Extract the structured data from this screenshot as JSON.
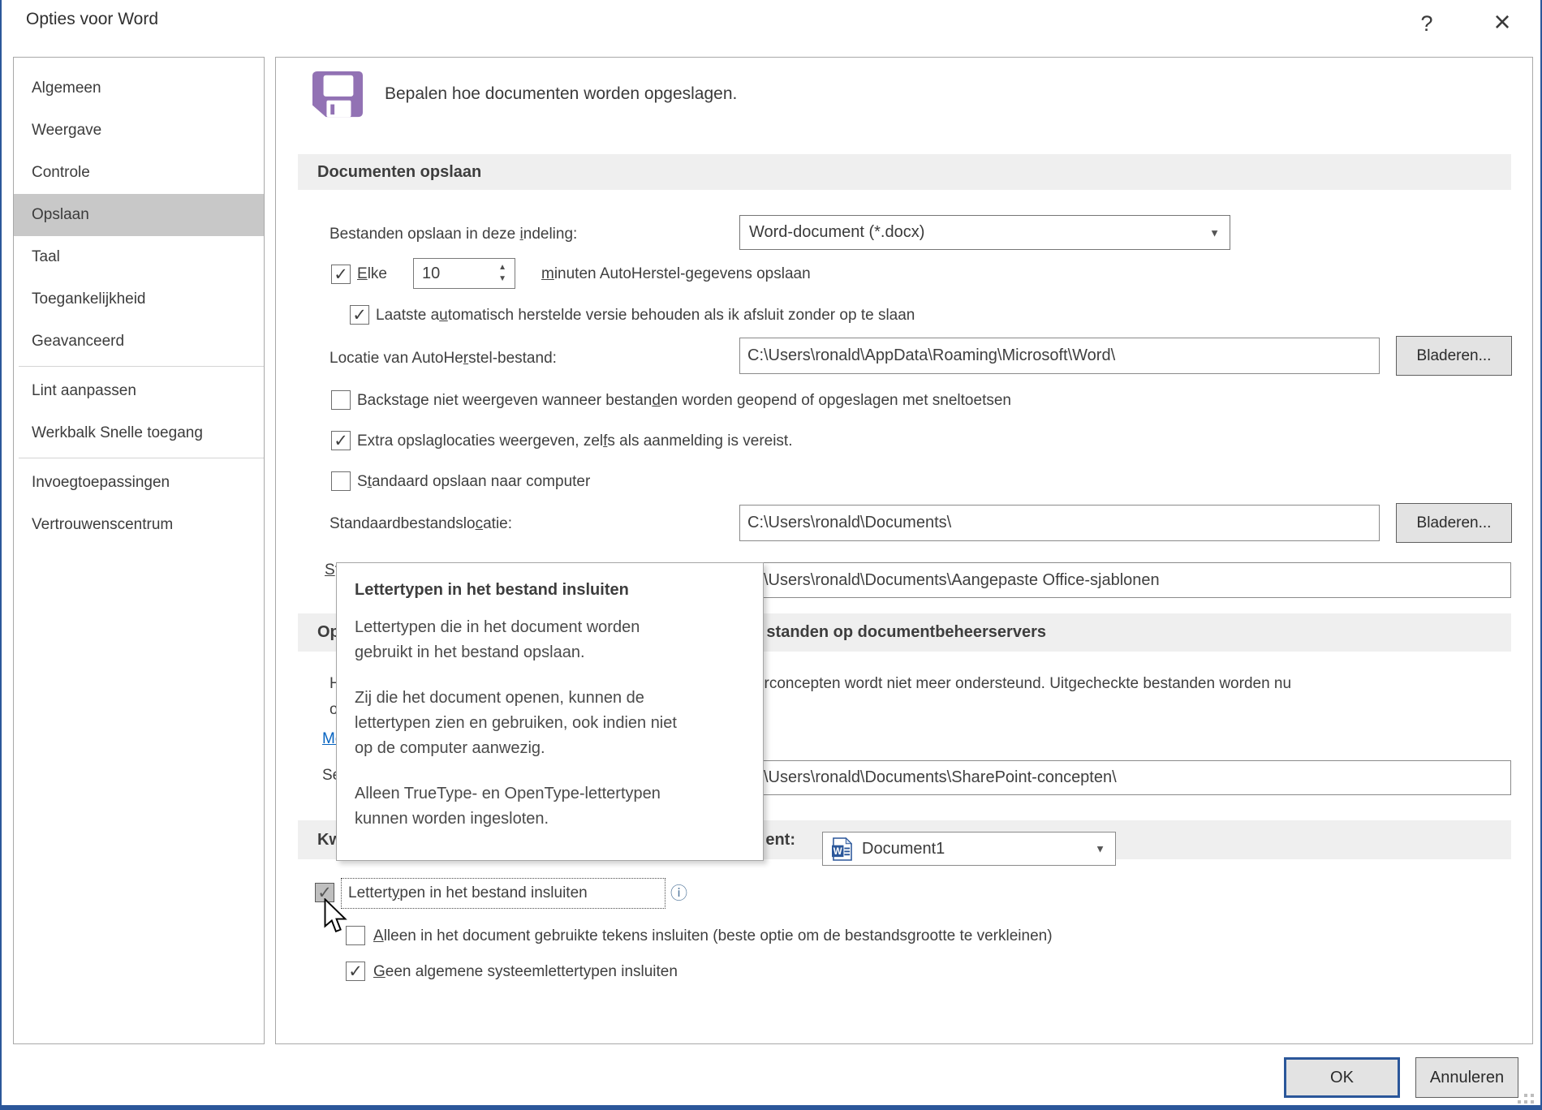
{
  "window": {
    "title": "Opties voor Word"
  },
  "icons": {
    "help": "?",
    "close": "×",
    "dropdown_arrow": "▼",
    "spinner_up": "▲",
    "spinner_down": "▼",
    "info": "ⓘ",
    "check": "✓"
  },
  "sidebar": {
    "items": [
      {
        "label": "Algemeen"
      },
      {
        "label": "Weergave"
      },
      {
        "label": "Controle"
      },
      {
        "label": "Opslaan",
        "selected": true
      },
      {
        "label": "Taal"
      },
      {
        "label": "Toegankelijkheid"
      },
      {
        "label": "Geavanceerd"
      },
      {
        "label": "Lint aanpassen"
      },
      {
        "label": "Werkbalk Snelle toegang"
      },
      {
        "label": "Invoegtoepassingen"
      },
      {
        "label": "Vertrouwenscentrum"
      }
    ]
  },
  "header": {
    "description": "Bepalen hoe documenten worden opgeslagen."
  },
  "save_section": {
    "title": "Documenten opslaan",
    "format_label": "Bestanden opslaan in deze indeling:",
    "format_value": "Word-document (*.docx)",
    "autorecover_prefix": "Elke",
    "autorecover_minutes": "10",
    "autorecover_suffix": "minuten AutoHerstel-gegevens opslaan",
    "keep_last_label": "Laatste automatisch herstelde versie behouden als ik afsluit zonder op te slaan",
    "autorecover_location_label": "Locatie van AutoHerstel-bestand:",
    "autorecover_location_value": "C:\\Users\\ronald\\AppData\\Roaming\\Microsoft\\Word\\",
    "browse_label": "Bladeren...",
    "backstage_label": "Backstage niet weergeven wanneer bestanden worden geopend of opgeslagen met sneltoetsen",
    "extra_locations_label": "Extra opslaglocaties weergeven, zelfs als aanmelding is vereist.",
    "default_computer_label": "Standaard opslaan naar computer",
    "default_location_label": "Standaardbestandslocatie:",
    "default_location_value": "C:\\Users\\ronald\\Documents\\",
    "templates_label_fragment": "St",
    "templates_value": "C:\\Users\\ronald\\Documents\\Aangepaste Office-sjablonen"
  },
  "offline_section": {
    "title": "Opties voor offline bewerken voor bestanden op documentbeheerservers",
    "body_line1": "Het opslaan van uitgecheckte bestanden op de server als serverconcepten wordt niet meer ondersteund. Uitgecheckte bestanden worden nu",
    "body_line2": "opgeslagen in de Office-documentcache.",
    "link_label": "Meer informatie",
    "server_drafts_label": "Serverconceptenlocatie:",
    "server_drafts_value": "C:\\Users\\ronald\\Documents\\SharePoint-concepten\\"
  },
  "quality_section": {
    "title": "Kwaliteit behouden bij het delen van dit document:",
    "document_value": "Document1",
    "embed_fonts_label": "Lettertypen in het bestand insluiten",
    "embed_used_only_label": "Alleen in het document gebruikte tekens insluiten (beste optie om de bestandsgrootte te verkleinen)",
    "no_system_fonts_label": "Geen algemene systeemlettertypen insluiten"
  },
  "states": {
    "autorecover": true,
    "keep_last": true,
    "backstage": false,
    "extra_locations": true,
    "default_computer": false,
    "embed_fonts": true,
    "embed_used_only": false,
    "no_system_fonts": true
  },
  "tooltip": {
    "title": "Lettertypen in het bestand insluiten",
    "p1": "Lettertypen die in het document worden gebruikt in het bestand opslaan.",
    "p2": "Zij die het document openen, kunnen de lettertypen zien en gebruiken, ook indien niet op de computer aanwezig.",
    "p3": "Alleen TrueType- en OpenType-lettertypen kunnen worden ingesloten."
  },
  "footer": {
    "ok_label": "OK",
    "cancel_label": "Annuleren"
  },
  "colors": {
    "accent": "#2b579a",
    "save_icon_purple": "#9272b4",
    "link": "#0563c1",
    "selected_sidebar": "#c8c8c8"
  }
}
